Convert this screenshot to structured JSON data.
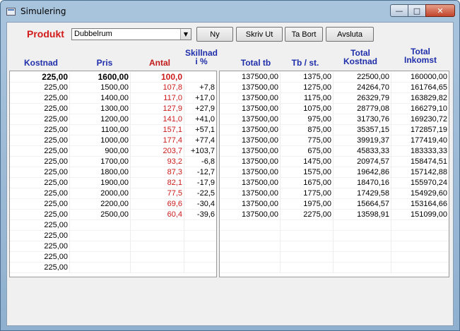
{
  "window": {
    "title": "Simulering",
    "min_icon": "minimize-icon",
    "max_icon": "maximize-icon",
    "close_icon": "close-icon"
  },
  "toolbar": {
    "produkt_label": "Produkt",
    "product_value": "Dubbelrum",
    "buttons": {
      "ny": "Ny",
      "skriv_ut": "Skriv Ut",
      "ta_bort": "Ta Bort",
      "avsluta": "Avsluta"
    }
  },
  "headers": {
    "kostnad": "Kostnad",
    "pris": "Pris",
    "antal": "Antal",
    "skillnad_1": "Skillnad",
    "skillnad_2": "i %",
    "total_tb": "Total tb",
    "tb_st": "Tb / st.",
    "total_kostnad_1": "Total",
    "total_kostnad_2": "Kostnad",
    "total_inkomst_1": "Total",
    "total_inkomst_2": "Inkomst"
  },
  "colors": {
    "accent_red": "#cc1a1a",
    "header_blue": "#1f2eaa"
  },
  "left_rows": [
    [
      "225,00",
      "1600,00",
      "100,0",
      ""
    ],
    [
      "225,00",
      "1500,00",
      "107,8",
      "+7,8"
    ],
    [
      "225,00",
      "1400,00",
      "117,0",
      "+17,0"
    ],
    [
      "225,00",
      "1300,00",
      "127,9",
      "+27,9"
    ],
    [
      "225,00",
      "1200,00",
      "141,0",
      "+41,0"
    ],
    [
      "225,00",
      "1100,00",
      "157,1",
      "+57,1"
    ],
    [
      "225,00",
      "1000,00",
      "177,4",
      "+77,4"
    ],
    [
      "225,00",
      "900,00",
      "203,7",
      "+103,7"
    ],
    [
      "225,00",
      "1700,00",
      "93,2",
      "-6,8"
    ],
    [
      "225,00",
      "1800,00",
      "87,3",
      "-12,7"
    ],
    [
      "225,00",
      "1900,00",
      "82,1",
      "-17,9"
    ],
    [
      "225,00",
      "2000,00",
      "77,5",
      "-22,5"
    ],
    [
      "225,00",
      "2200,00",
      "69,6",
      "-30,4"
    ],
    [
      "225,00",
      "2500,00",
      "60,4",
      "-39,6"
    ],
    [
      "225,00",
      "",
      "",
      ""
    ],
    [
      "225,00",
      "",
      "",
      ""
    ],
    [
      "225,00",
      "",
      "",
      ""
    ],
    [
      "225,00",
      "",
      "",
      ""
    ],
    [
      "225,00",
      "",
      "",
      ""
    ]
  ],
  "right_rows": [
    [
      "137500,00",
      "1375,00",
      "22500,00",
      "160000,00"
    ],
    [
      "137500,00",
      "1275,00",
      "24264,70",
      "161764,65"
    ],
    [
      "137500,00",
      "1175,00",
      "26329,79",
      "163829,82"
    ],
    [
      "137500,00",
      "1075,00",
      "28779,08",
      "166279,10"
    ],
    [
      "137500,00",
      "975,00",
      "31730,76",
      "169230,72"
    ],
    [
      "137500,00",
      "875,00",
      "35357,15",
      "172857,19"
    ],
    [
      "137500,00",
      "775,00",
      "39919,37",
      "177419,40"
    ],
    [
      "137500,00",
      "675,00",
      "45833,33",
      "183333,33"
    ],
    [
      "137500,00",
      "1475,00",
      "20974,57",
      "158474,51"
    ],
    [
      "137500,00",
      "1575,00",
      "19642,86",
      "157142,88"
    ],
    [
      "137500,00",
      "1675,00",
      "18470,16",
      "155970,24"
    ],
    [
      "137500,00",
      "1775,00",
      "17429,58",
      "154929,60"
    ],
    [
      "137500,00",
      "1975,00",
      "15664,57",
      "153164,66"
    ],
    [
      "137500,00",
      "2275,00",
      "13598,91",
      "151099,00"
    ],
    [
      "",
      "",
      "",
      ""
    ],
    [
      "",
      "",
      "",
      ""
    ],
    [
      "",
      "",
      "",
      ""
    ],
    [
      "",
      "",
      "",
      ""
    ],
    [
      "",
      "",
      "",
      ""
    ]
  ]
}
